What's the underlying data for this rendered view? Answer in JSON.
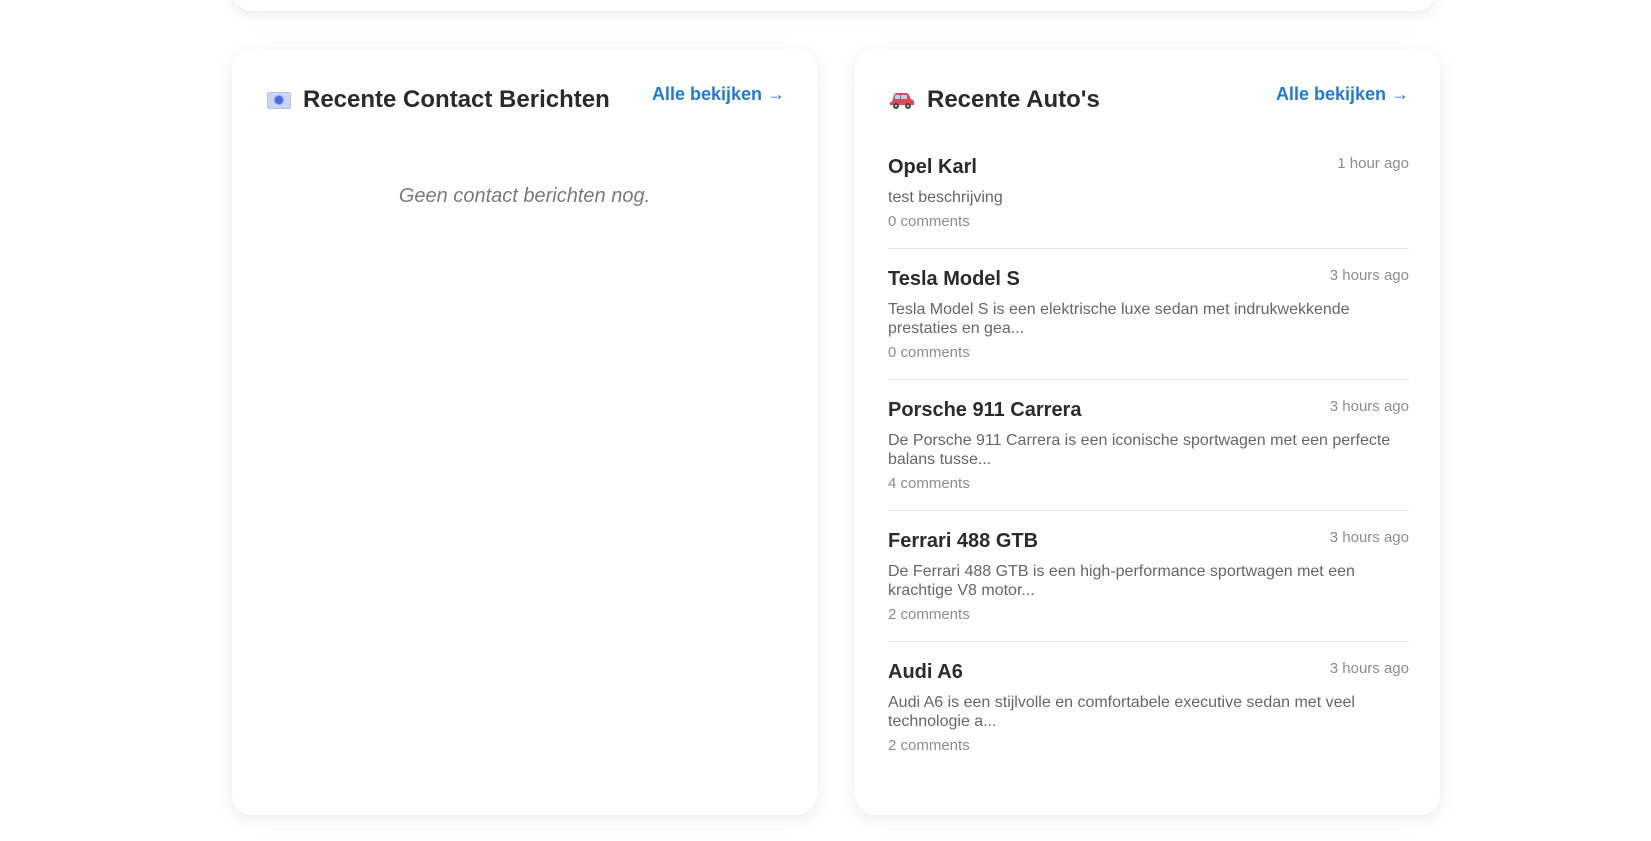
{
  "contact_panel": {
    "title": "Recente Contact Berichten",
    "view_all": "Alle bekijken →",
    "empty_message": "Geen contact berichten nog.",
    "icon": "envelope-icon"
  },
  "cars_panel": {
    "title": "Recente Auto's",
    "view_all": "Alle bekijken →",
    "icon": "car-icon",
    "items": [
      {
        "name": "Opel Karl",
        "time": "1 hour ago",
        "description": "test beschrijving",
        "comments": "0 comments"
      },
      {
        "name": "Tesla Model S",
        "time": "3 hours ago",
        "description": "Tesla Model S is een elektrische luxe sedan met indrukwekkende prestaties en gea...",
        "comments": "0 comments"
      },
      {
        "name": "Porsche 911 Carrera",
        "time": "3 hours ago",
        "description": "De Porsche 911 Carrera is een iconische sportwagen met een perfecte balans tusse...",
        "comments": "4 comments"
      },
      {
        "name": "Ferrari 488 GTB",
        "time": "3 hours ago",
        "description": "De Ferrari 488 GTB is een high-performance sportwagen met een krachtige V8 motor...",
        "comments": "2 comments"
      },
      {
        "name": "Audi A6",
        "time": "3 hours ago",
        "description": "Audi A6 is een stijlvolle en comfortabele executive sedan met veel technologie a...",
        "comments": "2 comments"
      }
    ]
  },
  "colors": {
    "link": "#1e7bdc",
    "title": "#2b2b2b",
    "muted": "#8c8c8c"
  }
}
